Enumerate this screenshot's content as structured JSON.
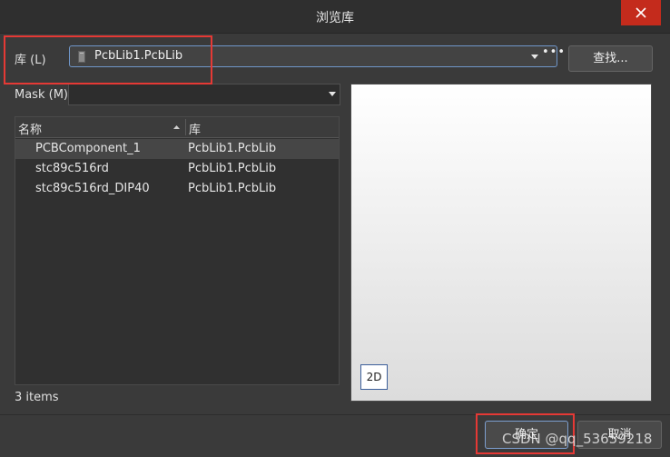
{
  "window": {
    "title": "浏览库"
  },
  "library": {
    "label": "库 (L)",
    "value": "PcbLib1.PcbLib",
    "more": "•••"
  },
  "find_button": "查找...",
  "mask": {
    "label": "Mask (M)",
    "value": ""
  },
  "table": {
    "columns": [
      "名称",
      "库"
    ],
    "rows": [
      {
        "name": "PCBComponent_1",
        "library": "PcbLib1.PcbLib",
        "selected": true
      },
      {
        "name": "stc89c516rd",
        "library": "PcbLib1.PcbLib",
        "selected": false
      },
      {
        "name": "stc89c516rd_DIP40",
        "library": "PcbLib1.PcbLib",
        "selected": false
      }
    ]
  },
  "status": "3 items",
  "preview": {
    "mode_button": "2D"
  },
  "buttons": {
    "ok": "确定",
    "cancel": "取消"
  },
  "watermark": "CSDN @qq_53659218",
  "colors": {
    "background": "#3a3a3a",
    "close": "#c42b1c",
    "annotation": "#e53935",
    "focus": "#6f96c9"
  },
  "icons": {
    "close": "close-icon",
    "library": "library-file-icon",
    "dropdown": "chevron-down-icon",
    "sort": "sort-ascending-icon"
  }
}
